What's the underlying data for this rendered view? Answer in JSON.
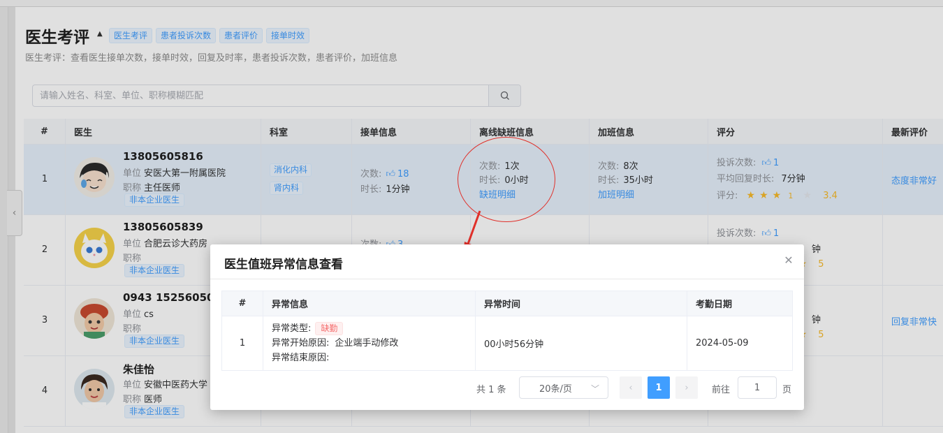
{
  "header": {
    "title": "医生考评",
    "tags": [
      "医生考评",
      "患者投诉次数",
      "患者评价",
      "接单时效"
    ],
    "description": "医生考评：查看医生接单次数，接单时效，回复及时率，患者投诉次数，患者评价，加班信息"
  },
  "search": {
    "placeholder": "请输入姓名、科室、单位、职称模糊匹配"
  },
  "table": {
    "columns": [
      "#",
      "医生",
      "科室",
      "接单信息",
      "离线缺班信息",
      "加班信息",
      "评分",
      "最新评价"
    ],
    "labels": {
      "unit": "单位",
      "title": "职称",
      "count": "次数:",
      "duration": "时长:",
      "count2": "次数:",
      "duration2": "时长:",
      "complaints": "投诉次数:",
      "avg_reply": "平均回复时长:",
      "rating": "评分:",
      "absence_link": "缺班明细",
      "overtime_link": "加班明细"
    },
    "rows": [
      {
        "index": "1",
        "phone": "13805605816",
        "unit": "安医大第一附属医院",
        "title": "主任医师",
        "badge": "非本企业医生",
        "depts": [
          "消化内科",
          "肾内科"
        ],
        "orders_count": "18",
        "orders_duration": "1分钟",
        "absence_count": "1次",
        "absence_duration": "0小时",
        "overtime_count": "8次",
        "overtime_duration": "35小时",
        "complaints": "1",
        "avg_reply": "7分钟",
        "rating_stars_filled": 3,
        "rating_value": "3.4",
        "rating_partial": "1",
        "latest_review": "态度非常好"
      },
      {
        "index": "2",
        "phone": "13805605839",
        "unit": "合肥云诊大药房",
        "title": "",
        "badge": "非本企业医生",
        "orders_count": "3",
        "complaints": "1",
        "avg_reply_fragment": "钟",
        "rating_value": "5"
      },
      {
        "index": "3",
        "phone": "0943 152560509",
        "unit": "cs",
        "title": "",
        "badge": "非本企业医生",
        "avg_reply_fragment": "钟",
        "rating_value": "5",
        "latest_review": "回复非常快"
      },
      {
        "index": "4",
        "phone": "朱佳怡",
        "unit": "安徽中医药大学",
        "title": "医师",
        "badge": "非本企业医生"
      }
    ]
  },
  "modal": {
    "title": "医生值班异常信息查看",
    "columns": [
      "#",
      "异常信息",
      "异常时间",
      "考勤日期"
    ],
    "rows": [
      {
        "index": "1",
        "type_label": "异常类型:",
        "type_value": "缺勤",
        "start_label": "异常开始原因:",
        "start_value": "企业端手动修改",
        "end_label": "异常结束原因:",
        "end_value": "",
        "time": "00小时56分钟",
        "date": "2024-05-09"
      }
    ],
    "pagination": {
      "total": "共 1 条",
      "page_size": "20条/页",
      "current_page": "1",
      "goto_label": "前往",
      "goto_value": "1",
      "goto_unit": "页"
    }
  },
  "colors": {
    "primary": "#409eff",
    "selected_row": "#e6f1fc",
    "annotation": "#e0302a",
    "star": "#f7ba2a",
    "danger": "#f56c6c"
  }
}
